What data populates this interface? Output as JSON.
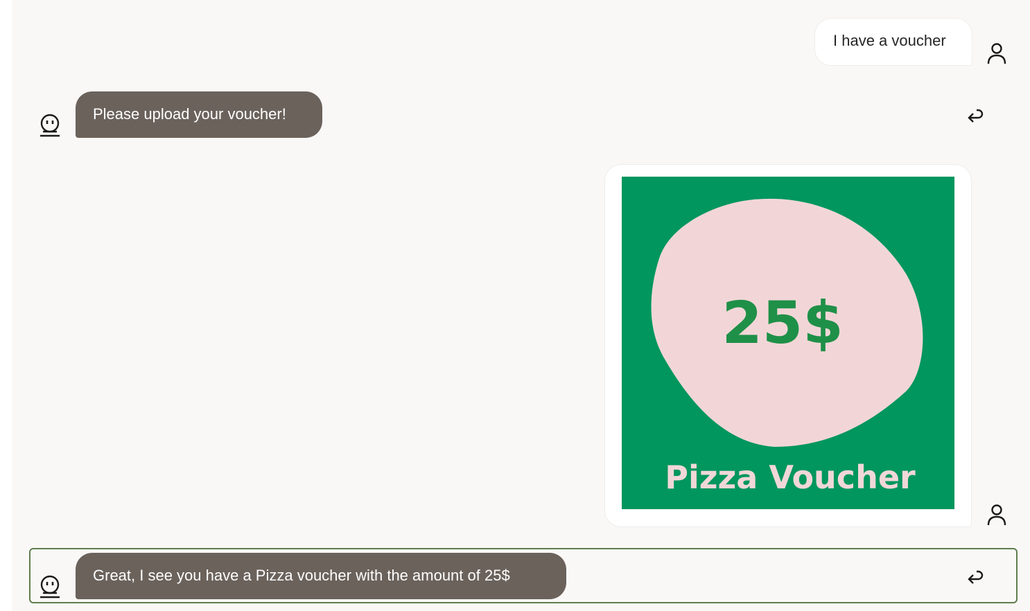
{
  "messages": [
    {
      "sender": "user",
      "text": "I have a voucher"
    },
    {
      "sender": "bot",
      "text": "Please upload your voucher!"
    },
    {
      "sender": "user",
      "attachment": {
        "amount": "25$",
        "title": "Pizza Voucher"
      }
    },
    {
      "sender": "bot",
      "text": "Great, I see you have a Pizza voucher with the amount of 25$"
    }
  ],
  "colors": {
    "panel_bg": "#f9f8f6",
    "bot_bubble": "#6b625c",
    "user_bubble": "#ffffff",
    "voucher_green": "#00965e",
    "voucher_pink": "#f2d6d7",
    "voucher_amount": "#1f9048",
    "focus_border": "#5f7d4f"
  },
  "icons": {
    "user_avatar": "person-outline-icon",
    "bot_avatar": "robot-icon",
    "reply": "reply-arrow-icon"
  }
}
